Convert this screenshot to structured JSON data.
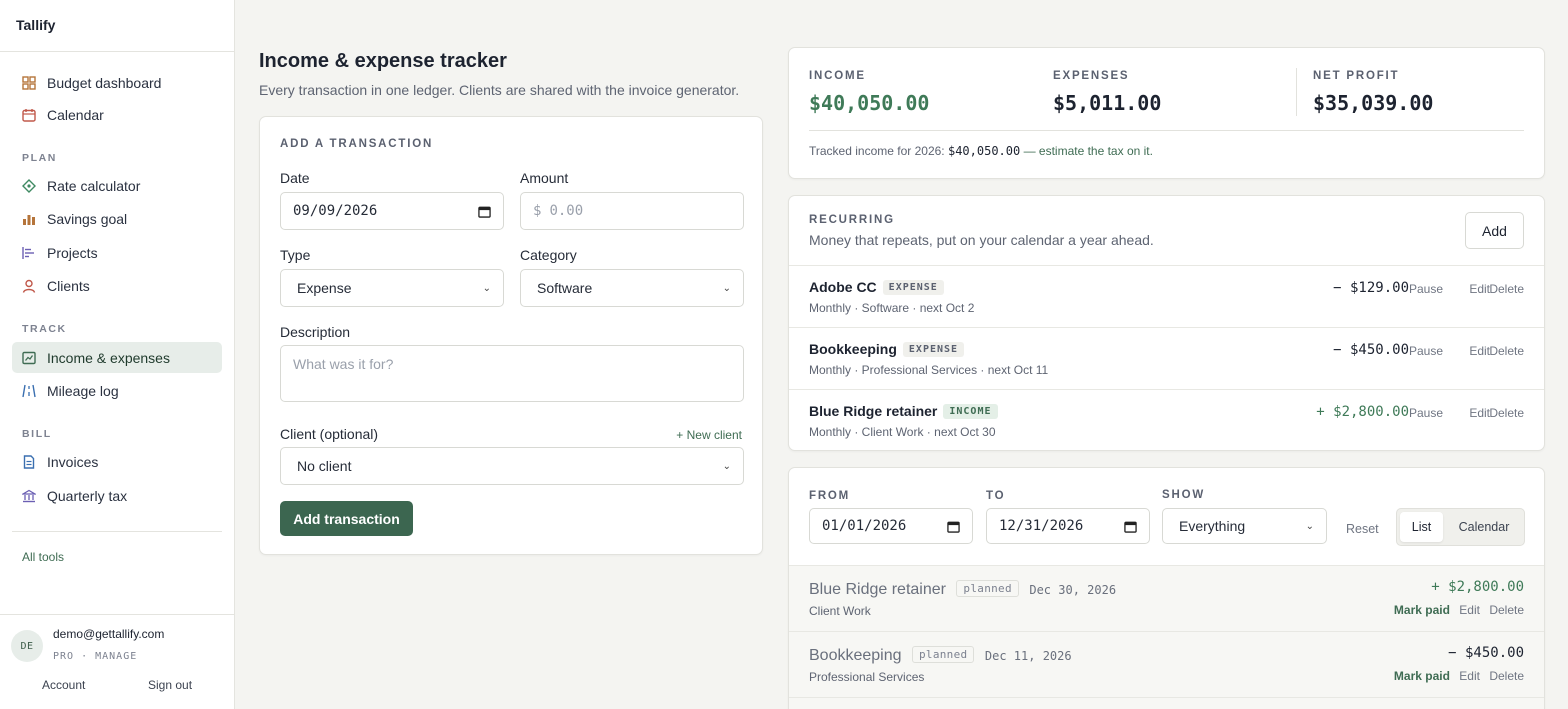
{
  "app": {
    "name": "Tallify"
  },
  "sidebar": {
    "top_items": [
      {
        "label": "Budget dashboard",
        "icon": "grid-icon"
      },
      {
        "label": "Calendar",
        "icon": "calendar-icon"
      }
    ],
    "sections": {
      "plan": "PLAN",
      "track": "TRACK",
      "bill": "BILL"
    },
    "plan_items": [
      {
        "label": "Rate calculator",
        "icon": "diamond-icon"
      },
      {
        "label": "Savings goal",
        "icon": "bar-chart-icon"
      },
      {
        "label": "Projects",
        "icon": "gantt-icon"
      },
      {
        "label": "Clients",
        "icon": "person-icon"
      }
    ],
    "track_items": [
      {
        "label": "Income & expenses",
        "icon": "ledger-icon",
        "active": true
      },
      {
        "label": "Mileage log",
        "icon": "road-icon"
      }
    ],
    "bill_items": [
      {
        "label": "Invoices",
        "icon": "document-icon"
      },
      {
        "label": "Quarterly tax",
        "icon": "bank-icon"
      }
    ],
    "all_tools": "All tools",
    "user": {
      "initials": "DE",
      "email": "demo@gettallify.com",
      "plan": "PRO · MANAGE",
      "account": "Account",
      "sign_out": "Sign out"
    }
  },
  "page": {
    "title": "Income & expense tracker",
    "subtitle": "Every transaction in one ledger. Clients are shared with the invoice generator."
  },
  "form": {
    "title": "ADD A TRANSACTION",
    "date_label": "Date",
    "date_value": "09/09/2026",
    "amount_label": "Amount",
    "amount_prefix": "$",
    "amount_placeholder": "0.00",
    "type_label": "Type",
    "type_value": "Expense",
    "category_label": "Category",
    "category_value": "Software",
    "description_label": "Description",
    "description_placeholder": "What was it for?",
    "client_label": "Client (optional)",
    "new_client": "+ New client",
    "client_value": "No client",
    "submit": "Add transaction"
  },
  "summary": {
    "income_label": "INCOME",
    "income_value": "$40,050.00",
    "expenses_label": "EXPENSES",
    "expenses_value": "$5,011.00",
    "net_label": "NET PROFIT",
    "net_value": "$35,039.00",
    "note_prefix": "Tracked income for 2026:",
    "note_amount": "$40,050.00",
    "note_link": "— estimate the tax on it."
  },
  "recurring": {
    "title": "RECURRING",
    "subtitle": "Money that repeats, put on your calendar a year ahead.",
    "add": "Add",
    "items": [
      {
        "name": "Adobe CC",
        "tag": "EXPENSE",
        "meta": "Monthly · Software · next Oct 2",
        "amount": "− $129.00"
      },
      {
        "name": "Bookkeeping",
        "tag": "EXPENSE",
        "meta": "Monthly · Professional Services · next Oct 11",
        "amount": "− $450.00"
      },
      {
        "name": "Blue Ridge retainer",
        "tag": "INCOME",
        "meta": "Monthly · Client Work · next Oct 30",
        "amount": "+ $2,800.00"
      }
    ],
    "actions": {
      "pause": "Pause",
      "edit": "Edit",
      "delete": "Delete"
    }
  },
  "filters": {
    "from_label": "FROM",
    "from_value": "01/01/2026",
    "to_label": "TO",
    "to_value": "12/31/2026",
    "show_label": "SHOW",
    "show_value": "Everything",
    "reset": "Reset",
    "view_list": "List",
    "view_calendar": "Calendar"
  },
  "transactions": [
    {
      "name": "Blue Ridge retainer",
      "tag": "planned",
      "date": "Dec 30, 2026",
      "category": "Client Work",
      "amount": "+ $2,800.00"
    },
    {
      "name": "Bookkeeping",
      "tag": "planned",
      "date": "Dec 11, 2026",
      "category": "Professional Services",
      "amount": "− $450.00"
    }
  ],
  "tx_actions": {
    "mark_paid": "Mark paid",
    "edit": "Edit",
    "delete": "Delete"
  },
  "colors": {
    "accent": "#3c6650",
    "income": "#3f7a58",
    "expense": "#1d2330",
    "active_bg": "#e7ede9"
  }
}
